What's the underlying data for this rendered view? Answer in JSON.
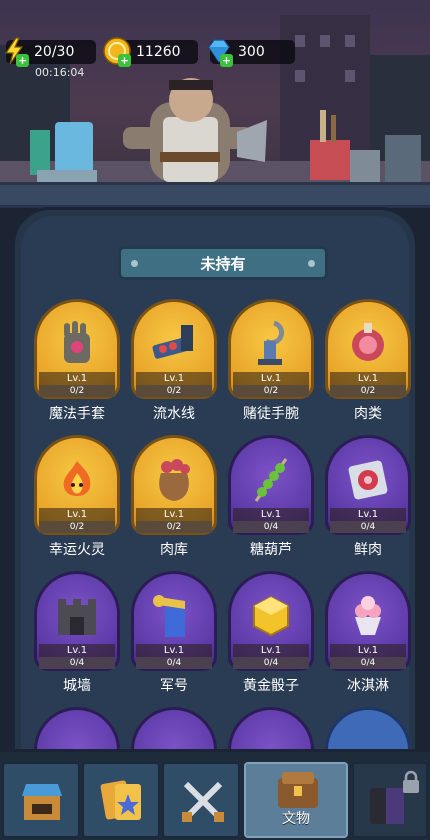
{
  "hud": {
    "energy": "20/30",
    "gold": "11260",
    "gems": "300",
    "timer": "00:16:04"
  },
  "status_banner": "未持有",
  "cards": [
    {
      "name": "魔法手套",
      "level": "Lv.1",
      "progress": "0/2",
      "rarity": "gold",
      "icon": "glove-icon"
    },
    {
      "name": "流水线",
      "level": "Lv.1",
      "progress": "0/2",
      "rarity": "gold",
      "icon": "conveyor-icon"
    },
    {
      "name": "赌徒手腕",
      "level": "Lv.1",
      "progress": "0/2",
      "rarity": "gold",
      "icon": "hook-icon"
    },
    {
      "name": "肉类",
      "level": "Lv.1",
      "progress": "0/2",
      "rarity": "gold",
      "icon": "meat-icon"
    },
    {
      "name": "幸运火灵",
      "level": "Lv.1",
      "progress": "0/2",
      "rarity": "gold",
      "icon": "fire-spirit-icon"
    },
    {
      "name": "肉库",
      "level": "Lv.1",
      "progress": "0/2",
      "rarity": "gold",
      "icon": "meat-sack-icon"
    },
    {
      "name": "糖葫芦",
      "level": "Lv.1",
      "progress": "0/4",
      "rarity": "purple",
      "icon": "candied-skewer-icon"
    },
    {
      "name": "鲜肉",
      "level": "Lv.1",
      "progress": "0/4",
      "rarity": "purple",
      "icon": "fresh-meat-icon"
    },
    {
      "name": "城墙",
      "level": "Lv.1",
      "progress": "0/4",
      "rarity": "purple",
      "icon": "wall-icon"
    },
    {
      "name": "军号",
      "level": "Lv.1",
      "progress": "0/4",
      "rarity": "purple",
      "icon": "bugle-icon"
    },
    {
      "name": "黄金骰子",
      "level": "Lv.1",
      "progress": "0/4",
      "rarity": "purple",
      "icon": "golden-dice-icon"
    },
    {
      "name": "冰淇淋",
      "level": "Lv.1",
      "progress": "0/4",
      "rarity": "purple",
      "icon": "ice-cream-icon"
    }
  ],
  "nav": {
    "items": [
      {
        "icon": "shop-icon",
        "label": ""
      },
      {
        "icon": "cards-icon",
        "label": ""
      },
      {
        "icon": "crossed-swords-icon",
        "label": ""
      },
      {
        "icon": "book-chest-icon",
        "label": "文物",
        "active": true
      },
      {
        "icon": "locked-tab-icon",
        "label": "",
        "locked": true
      }
    ]
  },
  "colors": {
    "gold_card": "#e9a52a",
    "purple_card": "#5c3aa6",
    "panel": "#2a3c53",
    "nav_active": "#5d7e98"
  }
}
